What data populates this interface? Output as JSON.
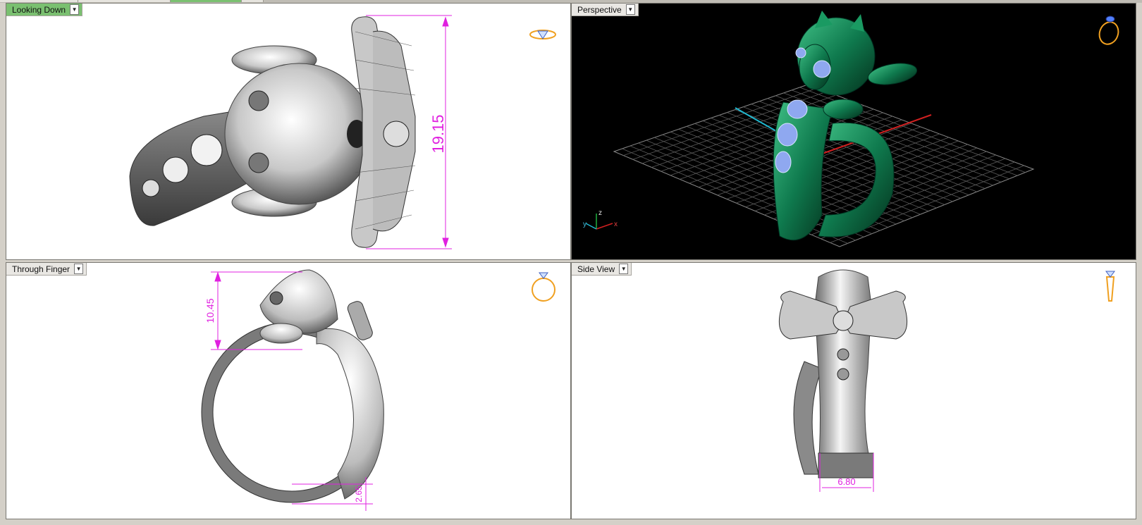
{
  "viewports": {
    "top": {
      "label": "Looking Down",
      "dimension": "19.15"
    },
    "perspective": {
      "label": "Perspective",
      "axis_x": "x",
      "axis_y": "y",
      "axis_z": "z"
    },
    "front": {
      "label": "Through Finger",
      "dimension_height": "10.45",
      "dimension_band": "2.65"
    },
    "side": {
      "label": "Side View",
      "dimension_width": "6.80"
    }
  },
  "colors": {
    "active_label": "#7ac070",
    "dimension": "#e020e0",
    "model_green": "#0f7a4e",
    "gem_blue": "#8fa8f0",
    "grid": "#8a8a8a",
    "icon_orange": "#f0a020"
  },
  "icons": [
    "diamond-ring-icon",
    "ring-perspective-icon",
    "ring-front-icon",
    "ring-side-icon",
    "dropdown-arrow-icon"
  ]
}
